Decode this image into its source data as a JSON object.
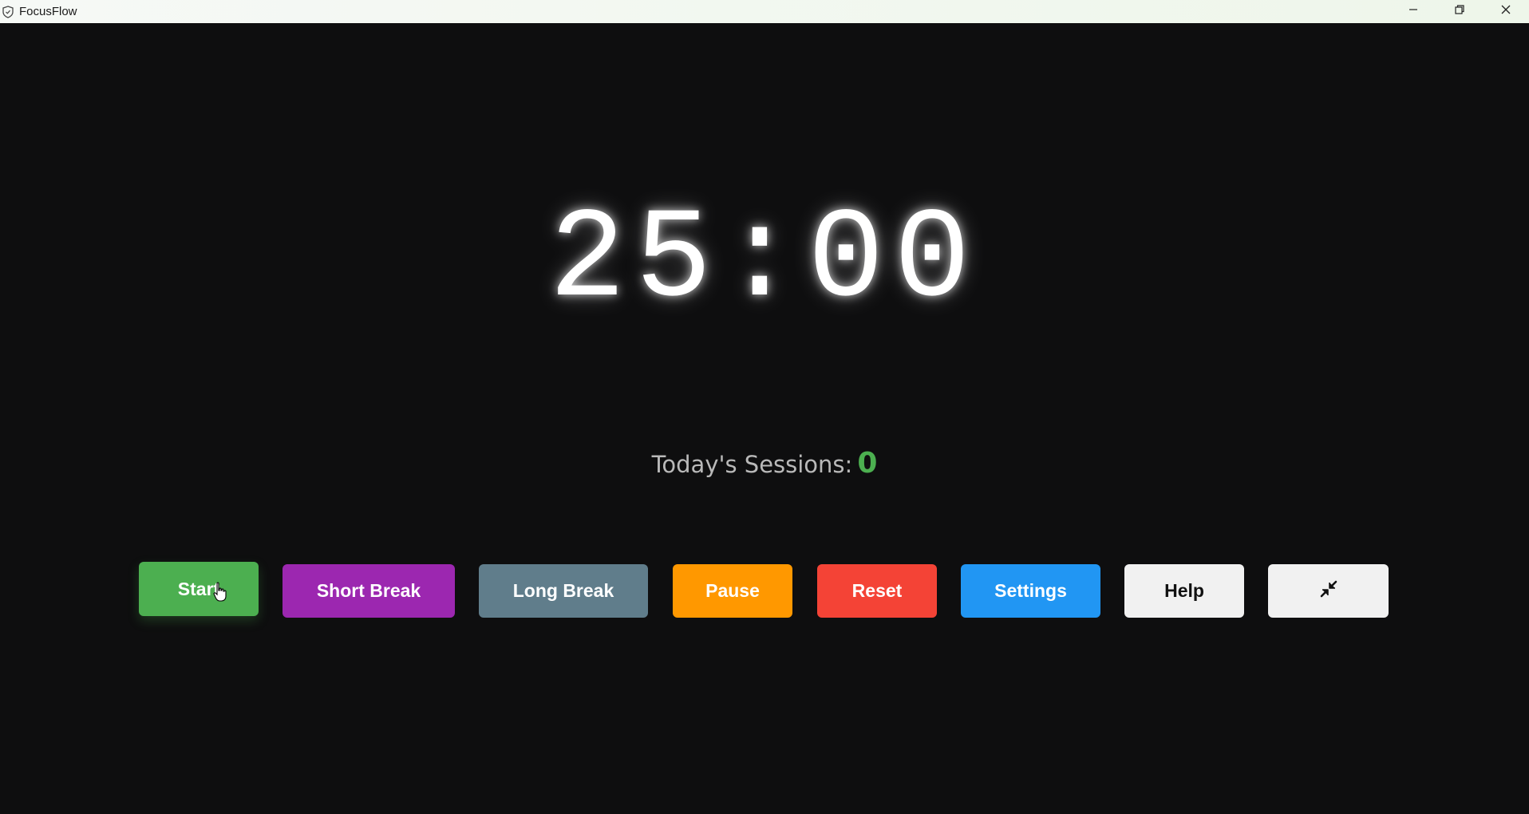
{
  "window": {
    "title": "FocusFlow",
    "icons": {
      "app": "shield-icon",
      "minimize": "minimize-icon",
      "restore": "restore-icon",
      "close": "close-icon"
    }
  },
  "timer": {
    "display": "25:00"
  },
  "sessions": {
    "label": "Today's Sessions:",
    "count": "0"
  },
  "controls": {
    "start": "Start",
    "short_break": "Short Break",
    "long_break": "Long Break",
    "pause": "Pause",
    "reset": "Reset",
    "settings": "Settings",
    "help": "Help",
    "compact_icon": "compress-arrows-icon"
  },
  "colors": {
    "start": "#4caf50",
    "short_break": "#9c27b0",
    "long_break": "#607d8b",
    "pause": "#ff9800",
    "reset": "#f44336",
    "settings": "#2196f3",
    "help": "#f1f1f1",
    "compact": "#f1f1f1",
    "background": "#0e0e0f",
    "session_count": "#4caf50"
  }
}
